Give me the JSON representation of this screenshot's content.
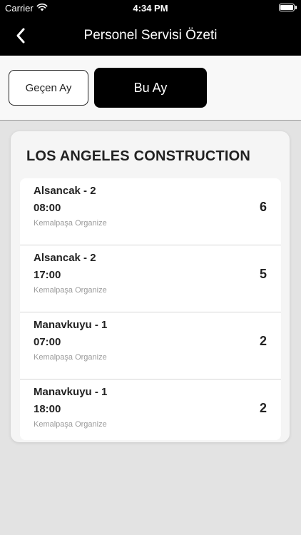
{
  "status": {
    "carrier": "Carrier",
    "time": "4:34 PM"
  },
  "nav": {
    "title": "Personel Servisi Özeti"
  },
  "segments": {
    "previous": "Geçen Ay",
    "current": "Bu Ay",
    "selected": "Bu Ay"
  },
  "company": "LOS ANGELES CONSTRUCTION",
  "services": [
    {
      "route": "Alsancak - 2",
      "time": "08:00",
      "place": "Kemalpaşa Organize",
      "count": "6"
    },
    {
      "route": "Alsancak - 2",
      "time": "17:00",
      "place": "Kemalpaşa Organize",
      "count": "5"
    },
    {
      "route": "Manavkuyu - 1",
      "time": "07:00",
      "place": "Kemalpaşa Organize",
      "count": "2"
    },
    {
      "route": "Manavkuyu - 1",
      "time": "18:00",
      "place": "Kemalpaşa Organize",
      "count": "2"
    }
  ]
}
